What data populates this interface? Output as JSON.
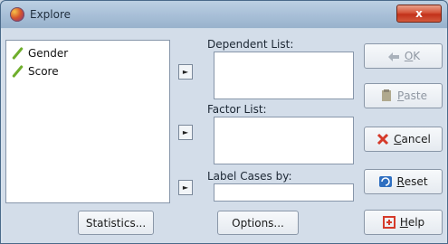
{
  "window": {
    "title": "Explore",
    "close_glyph": "x"
  },
  "variables": [
    {
      "name": "Gender",
      "icon": "scale-ruler-icon"
    },
    {
      "name": "Score",
      "icon": "scale-ruler-icon"
    }
  ],
  "targets": {
    "dependent_label": "Dependent List:",
    "factor_label": "Factor List:",
    "label_cases_label": "Label Cases by:"
  },
  "buttons": {
    "ok": {
      "mnemonic": "O",
      "rest": "K"
    },
    "paste": {
      "mnemonic": "P",
      "rest": "aste"
    },
    "cancel": {
      "mnemonic": "C",
      "rest": "ancel"
    },
    "reset": {
      "mnemonic": "R",
      "rest": "eset"
    },
    "help": {
      "mnemonic": "H",
      "rest": "elp"
    },
    "statistics": "Statistics...",
    "options": "Options..."
  },
  "arrow_glyph": "►",
  "colors": {
    "cancel_icon": "#d53a2a",
    "reset_icon": "#2f6fc1",
    "help_icon": "#d53a2a",
    "ruler_icon": "#6fae2c"
  }
}
